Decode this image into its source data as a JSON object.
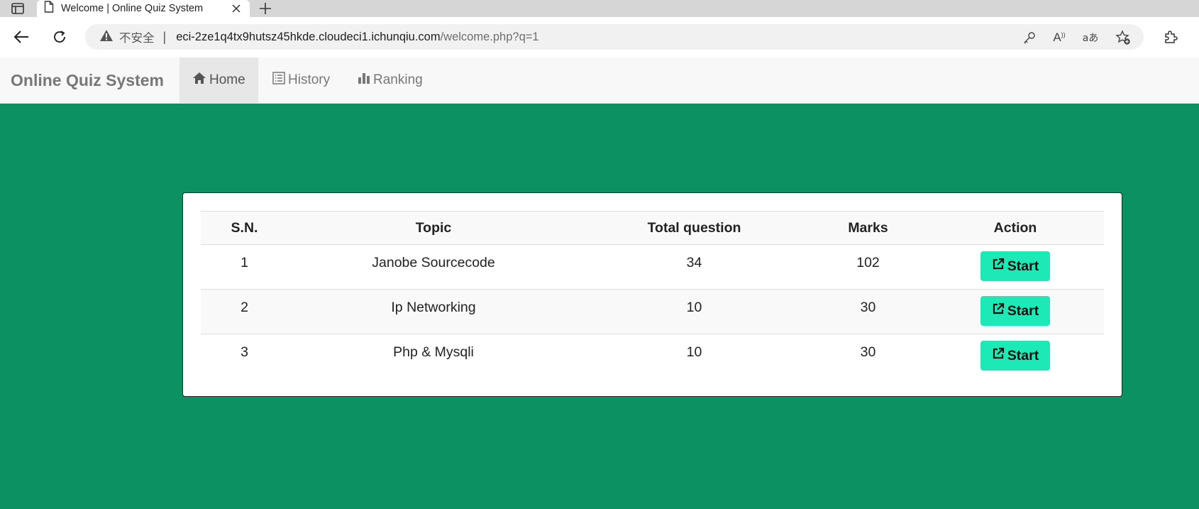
{
  "browser": {
    "tab_title": "Welcome | Online Quiz System",
    "security_label": "不安全",
    "url_host": "eci-2ze1q4tx9hutsz45hkde.cloudeci1.ichunqiu.com",
    "url_path": "/welcome.php?q=1",
    "read_aloud_glyph": "A",
    "translate_glyph": "aあ"
  },
  "navbar": {
    "brand": "Online Quiz System",
    "items": [
      {
        "label": "Home",
        "icon": "home-icon",
        "active": true
      },
      {
        "label": "History",
        "icon": "list-icon",
        "active": false
      },
      {
        "label": "Ranking",
        "icon": "bar-chart-icon",
        "active": false
      }
    ]
  },
  "table": {
    "headers": [
      "S.N.",
      "Topic",
      "Total question",
      "Marks",
      "Action"
    ],
    "rows": [
      {
        "sn": "1",
        "topic": "Janobe Sourcecode",
        "total": "34",
        "marks": "102",
        "action": "Start"
      },
      {
        "sn": "2",
        "topic": "Ip Networking",
        "total": "10",
        "marks": "30",
        "action": "Start"
      },
      {
        "sn": "3",
        "topic": "Php & Mysqli",
        "total": "10",
        "marks": "30",
        "action": "Start"
      }
    ]
  },
  "colors": {
    "page_background": "#0c9163",
    "start_button": "#1de9b6",
    "navbar_background": "#f8f8f8"
  }
}
